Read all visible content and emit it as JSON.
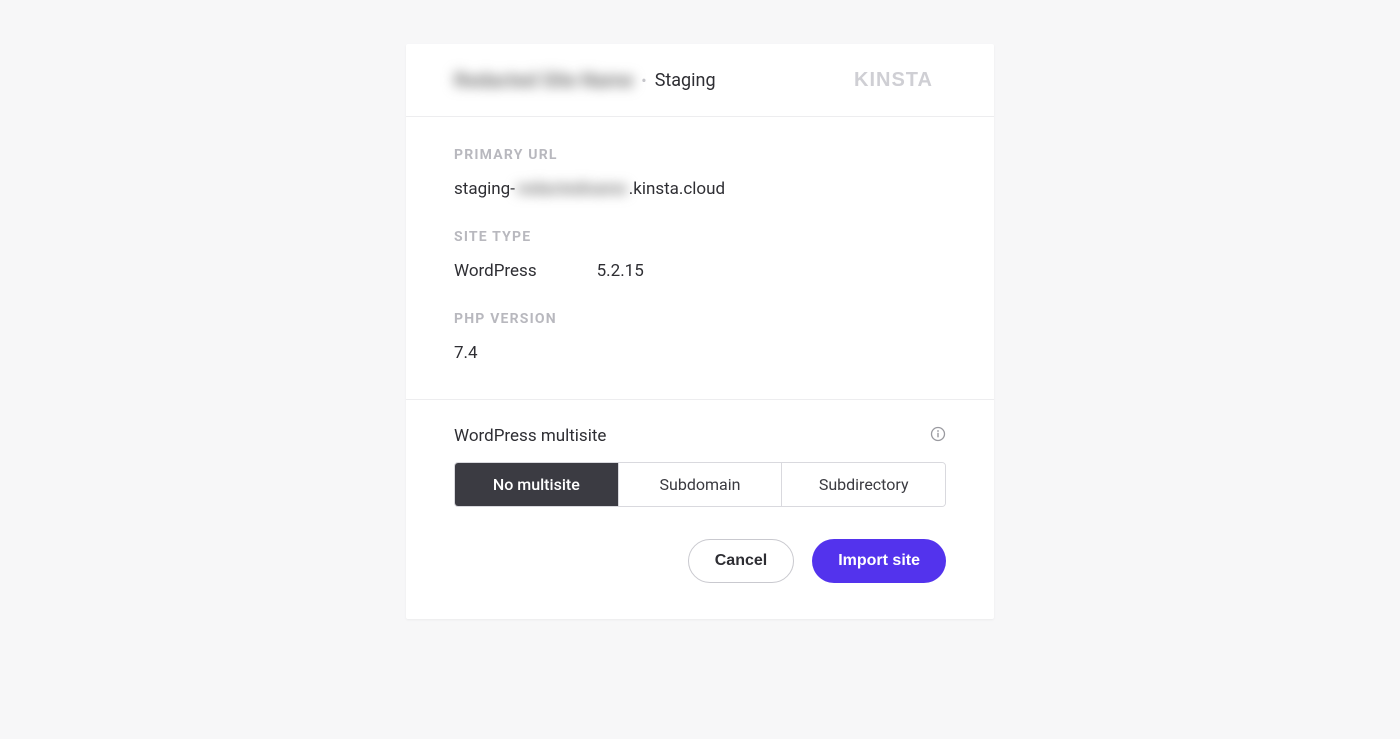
{
  "header": {
    "site_name_redacted": "Redacted Site Name",
    "separator_glyph": "•",
    "env_label": "Staging",
    "logo_name": "kinsta"
  },
  "sections": {
    "primary_url": {
      "label": "PRIMARY URL",
      "prefix": "staging-",
      "redacted_mid": "redactedname",
      "suffix": ".kinsta.cloud"
    },
    "site_type": {
      "label": "SITE TYPE",
      "platform": "WordPress",
      "version": "5.2.15"
    },
    "php_version": {
      "label": "PHP VERSION",
      "value": "7.4"
    }
  },
  "multisite": {
    "title": "WordPress multisite",
    "info_icon": "info-icon",
    "options": {
      "no_multisite": "No multisite",
      "subdomain": "Subdomain",
      "subdirectory": "Subdirectory"
    },
    "selected": "no_multisite"
  },
  "footer": {
    "cancel": "Cancel",
    "import": "Import site"
  },
  "colors": {
    "accent": "#5333ed",
    "segment_active_bg": "#3b3b42",
    "label_muted": "#b8b8be",
    "border": "#d9d9de"
  }
}
